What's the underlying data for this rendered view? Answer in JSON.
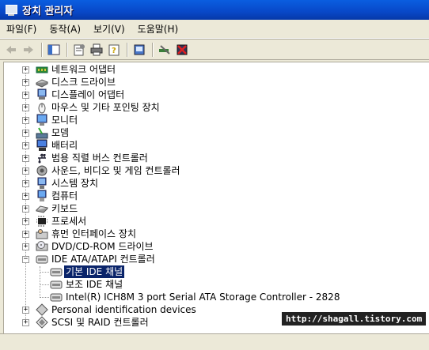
{
  "window": {
    "title": "장치 관리자"
  },
  "menu": [
    {
      "label": "파일(F)"
    },
    {
      "label": "동작(A)"
    },
    {
      "label": "보기(V)"
    },
    {
      "label": "도움말(H)"
    }
  ],
  "toolbar": {
    "back": "back-arrow-icon",
    "forward": "forward-arrow-icon"
  },
  "tree": [
    {
      "label": "네트워크 어댑터",
      "icon": "network-adapter-icon",
      "expanded": false
    },
    {
      "label": "디스크 드라이브",
      "icon": "disk-drive-icon",
      "expanded": false
    },
    {
      "label": "디스플레이 어댑터",
      "icon": "display-adapter-icon",
      "expanded": false
    },
    {
      "label": "마우스 및 기타 포인팅 장치",
      "icon": "mouse-icon",
      "expanded": false
    },
    {
      "label": "모니터",
      "icon": "monitor-icon",
      "expanded": false
    },
    {
      "label": "모뎀",
      "icon": "modem-icon",
      "expanded": false
    },
    {
      "label": "배터리",
      "icon": "battery-icon",
      "expanded": false
    },
    {
      "label": "범용 직렬 버스 컨트롤러",
      "icon": "usb-icon",
      "expanded": false
    },
    {
      "label": "사운드, 비디오 및 게임 컨트롤러",
      "icon": "sound-icon",
      "expanded": false
    },
    {
      "label": "시스템 장치",
      "icon": "system-device-icon",
      "expanded": false
    },
    {
      "label": "컴퓨터",
      "icon": "computer-icon",
      "expanded": false
    },
    {
      "label": "키보드",
      "icon": "keyboard-icon",
      "expanded": false
    },
    {
      "label": "프로세서",
      "icon": "processor-icon",
      "expanded": false
    },
    {
      "label": "휴먼 인터페이스 장치",
      "icon": "hid-icon",
      "expanded": false
    },
    {
      "label": "DVD/CD-ROM 드라이브",
      "icon": "cdrom-icon",
      "expanded": false
    },
    {
      "label": "IDE ATA/ATAPI 컨트롤러",
      "icon": "ide-controller-icon",
      "expanded": true,
      "children": [
        {
          "label": "기본 IDE 채널",
          "icon": "ide-channel-icon",
          "selected": true
        },
        {
          "label": "보조 IDE 채널",
          "icon": "ide-channel-icon",
          "selected": false
        },
        {
          "label": "Intel(R) ICH8M 3 port Serial ATA Storage Controller - 2828",
          "icon": "ide-channel-icon",
          "selected": false
        }
      ]
    },
    {
      "label": "Personal identification devices",
      "icon": "personal-id-icon",
      "expanded": false
    },
    {
      "label": "SCSI 및 RAID 컨트롤러",
      "icon": "scsi-icon",
      "expanded": false
    }
  ],
  "watermark": "http://shagall.tistory.com",
  "colors": {
    "title_bar": "#0848c8",
    "selection": "#0a246a",
    "chrome": "#ece9d8"
  }
}
